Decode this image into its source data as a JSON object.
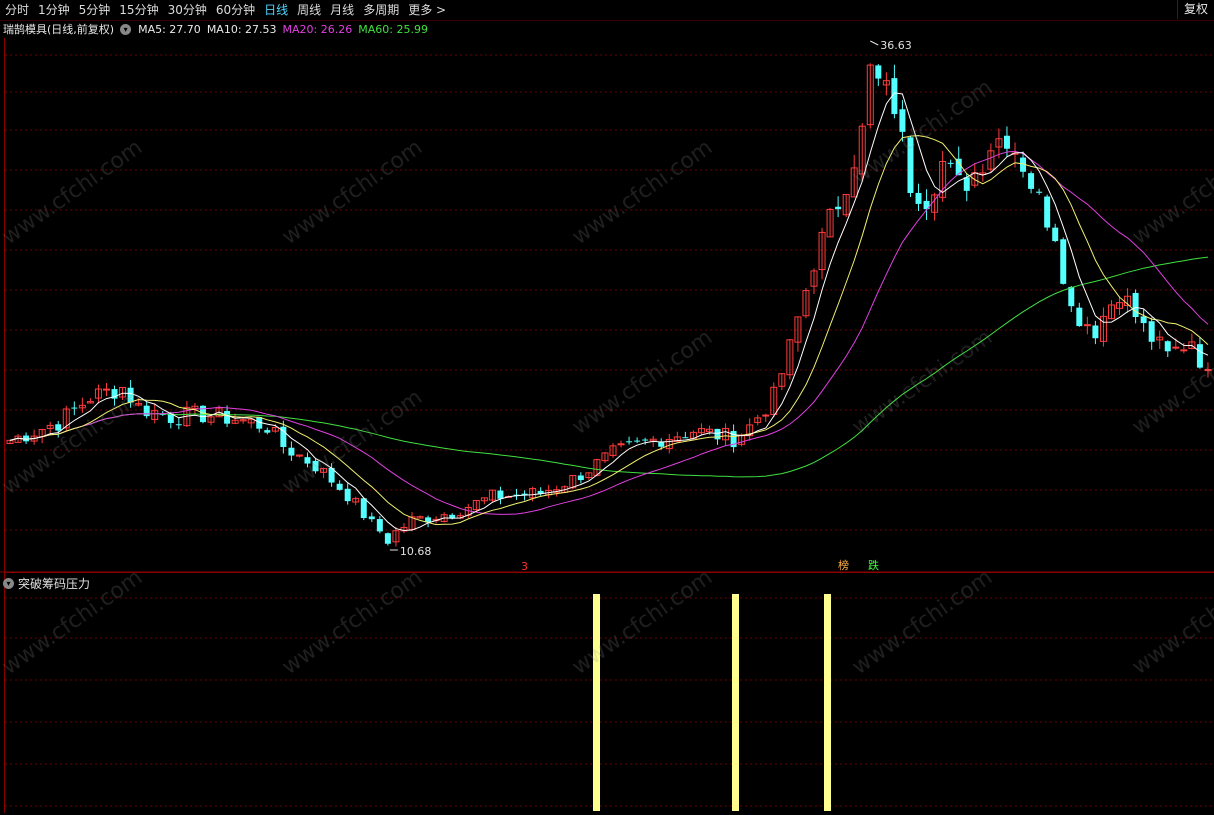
{
  "toolbar": {
    "tabs": [
      "分时",
      "1分钟",
      "5分钟",
      "15分钟",
      "30分钟",
      "60分钟",
      "日线",
      "周线",
      "月线",
      "多周期",
      "更多 >"
    ],
    "active_tab": "日线",
    "fq_button": "复权"
  },
  "legend": {
    "title": "瑞鹄模具(日线,前复权)",
    "ma5": "MA5: 27.70",
    "ma10": "MA10: 27.53",
    "ma20": "MA20: 26.26",
    "ma60": "MA60: 25.99"
  },
  "colors": {
    "up": "#ff3c3c",
    "down": "#54ffff",
    "ma5": "#ffffff",
    "ma10": "#f0f070",
    "ma20": "#e040e0",
    "ma60": "#40e040",
    "bar": "#ffff90",
    "grid": "#6a0000"
  },
  "annotations": {
    "high_label": "36.63",
    "low_label": "10.68",
    "marker_3": "3",
    "marker_bang": "榜",
    "marker_die": "跌"
  },
  "subchart": {
    "title": "突破筹码压力"
  },
  "watermark": "www.cfchi.com",
  "chart_data": {
    "type": "candlestick",
    "title": "瑞鹄模具(日线,前复权)",
    "price_high": 36.63,
    "price_low": 10.68,
    "series": [
      {
        "name": "MA5",
        "last": 27.7
      },
      {
        "name": "MA10",
        "last": 27.53
      },
      {
        "name": "MA20",
        "last": 26.26
      },
      {
        "name": "MA60",
        "last": 25.99
      }
    ],
    "subchart_title": "突破筹码压力",
    "signal_bar_count": 3
  }
}
